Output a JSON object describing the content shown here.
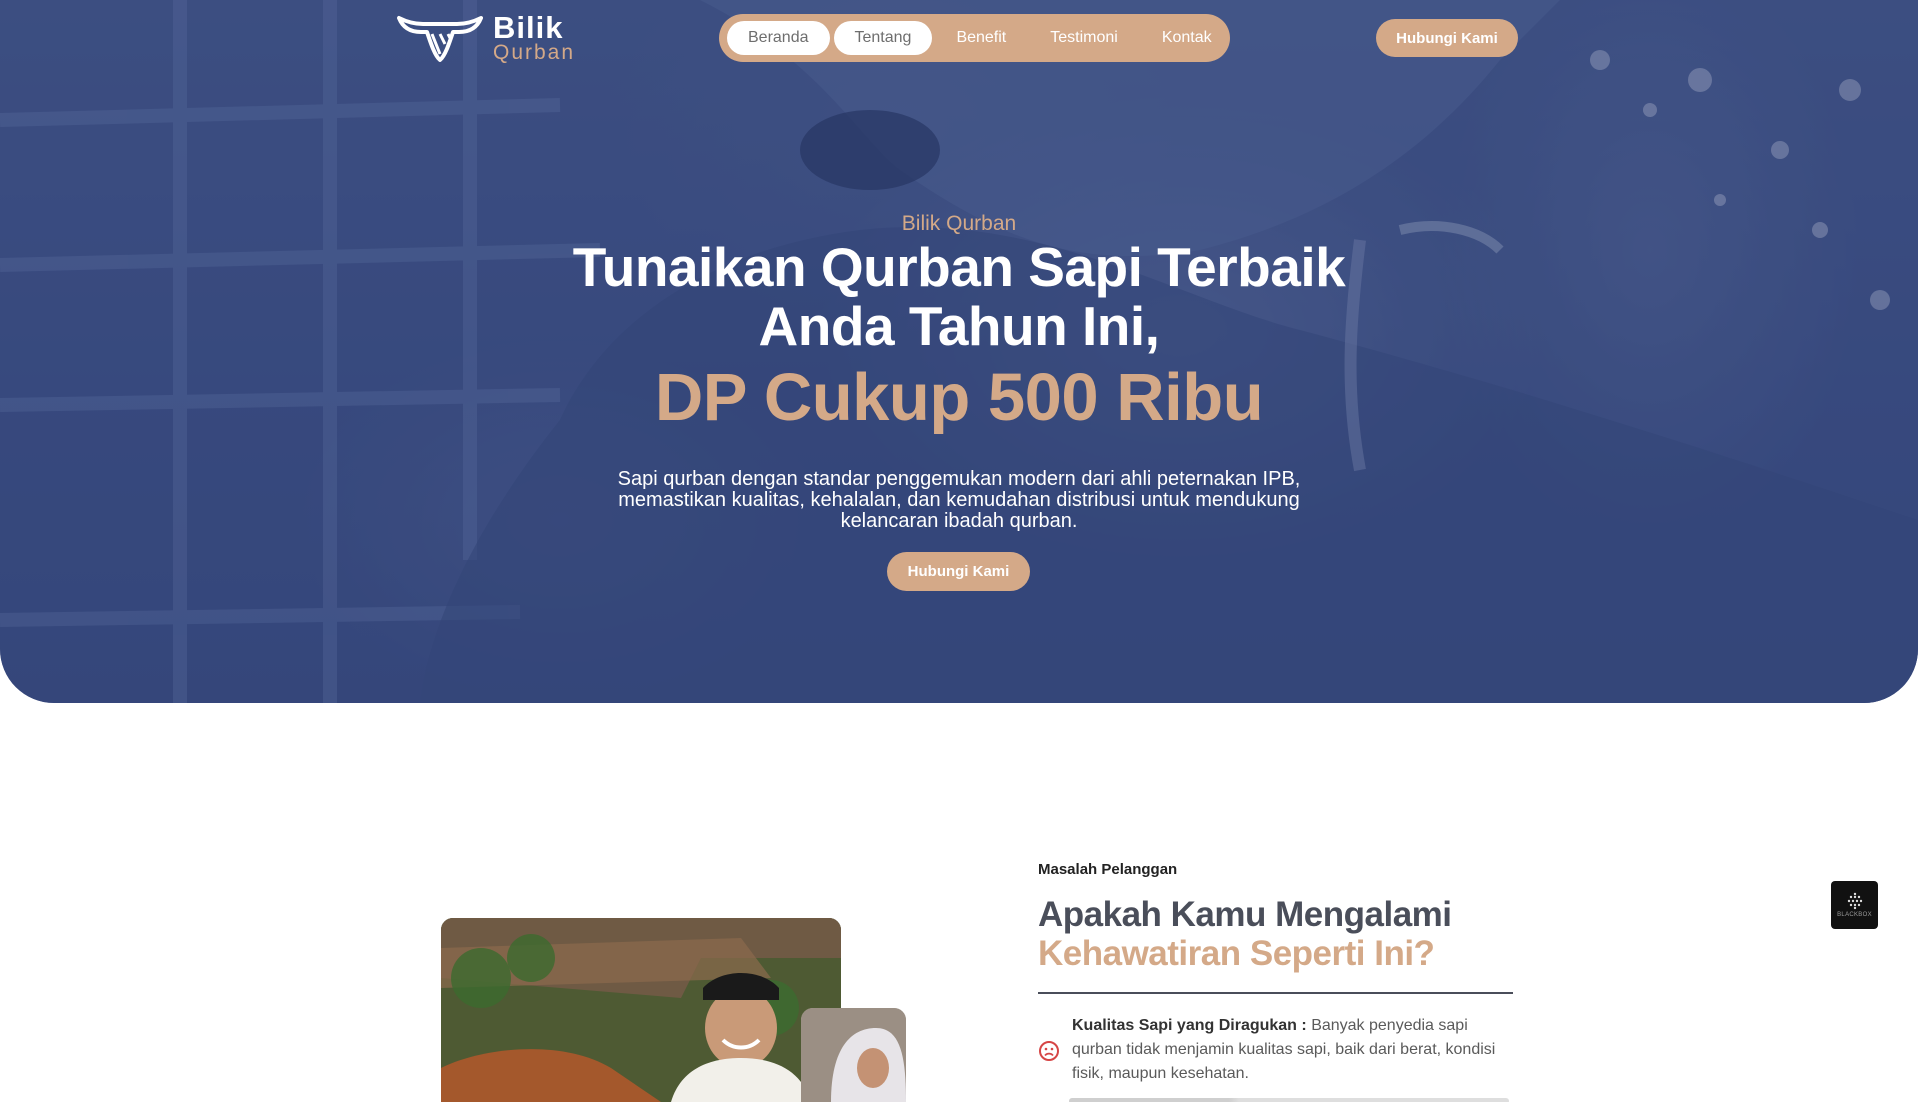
{
  "colors": {
    "accent": "#d4a988",
    "hero_overlay": "#3f5286",
    "heading_dark": "#4a4e5a",
    "white": "#ffffff"
  },
  "header": {
    "logo": {
      "brand": "Bilik",
      "sub": "Qurban",
      "icon": "bull-head-icon"
    },
    "nav": [
      {
        "label": "Beranda",
        "state": "active"
      },
      {
        "label": "Tentang",
        "state": "active"
      },
      {
        "label": "Benefit",
        "state": "default"
      },
      {
        "label": "Testimoni",
        "state": "default"
      },
      {
        "label": "Kontak",
        "state": "default"
      }
    ],
    "cta_label": "Hubungi Kami"
  },
  "hero": {
    "eyebrow": "Bilik Qurban",
    "headline_line1": "Tunaikan Qurban Sapi Terbaik",
    "headline_line2": "Anda Tahun Ini,",
    "headline_accent": "DP Cukup 500 Ribu",
    "description_lines": [
      "Sapi qurban dengan standar penggemukan modern dari ahli peternakan IPB,",
      "memastikan kualitas, kehalalan, dan kemudahan distribusi untuk mendukung",
      "kelancaran ibadah qurban."
    ],
    "cta_label": "Hubungi Kami"
  },
  "problems_section": {
    "label": "Masalah Pelanggan",
    "title_line1": "Apakah Kamu Mengalami",
    "title_line2": "Kehawatiran Seperti Ini?",
    "items": [
      {
        "icon": "sad-face-icon",
        "title": "Kualitas Sapi yang Diragukan :",
        "text": "Banyak penyedia sapi qurban tidak menjamin kualitas sapi, baik dari berat, kondisi fisik, maupun kesehatan."
      }
    ]
  },
  "floating_badge": {
    "label": "BLACKBOX",
    "icon": "blackbox-logo-icon"
  }
}
